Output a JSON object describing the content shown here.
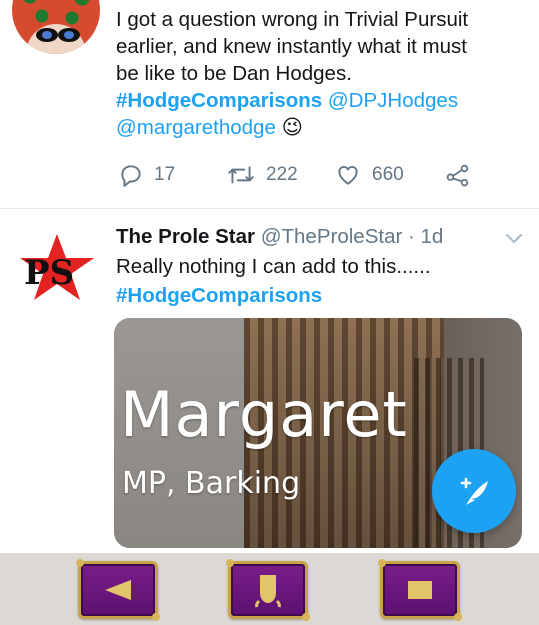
{
  "tweet1": {
    "text_line1": "I got a question wrong in Trivial Pursuit",
    "text_line2": "earlier, and knew instantly what it must",
    "text_line3": "be like to be Dan Hodges.",
    "hashtag": "#HodgeComparisons",
    "mention1": "@DPJHodges",
    "mention2": "@margarethodge",
    "emoji": "😉",
    "reply_count": "17",
    "retweet_count": "222",
    "like_count": "660"
  },
  "tweet2": {
    "display_name": "The Prole Star",
    "handle": "@TheProleStar",
    "separator": "·",
    "time": "1d",
    "text": "Really nothing I can add to this......",
    "hashtag": "#HodgeComparisons",
    "media": {
      "title": "Margaret",
      "subtitle": "MP, Barking"
    }
  },
  "colors": {
    "link": "#1da1f2",
    "fab": "#1da1f2",
    "nav_button": "#6b1580",
    "nav_border": "#c9a24a"
  },
  "icons": {
    "reply": "reply-icon",
    "retweet": "retweet-icon",
    "like": "heart-icon",
    "share": "share-icon",
    "compose": "compose-feather-icon",
    "nav_back": "back-triangle-icon",
    "nav_home": "home-icon",
    "nav_recent": "recent-square-icon"
  }
}
